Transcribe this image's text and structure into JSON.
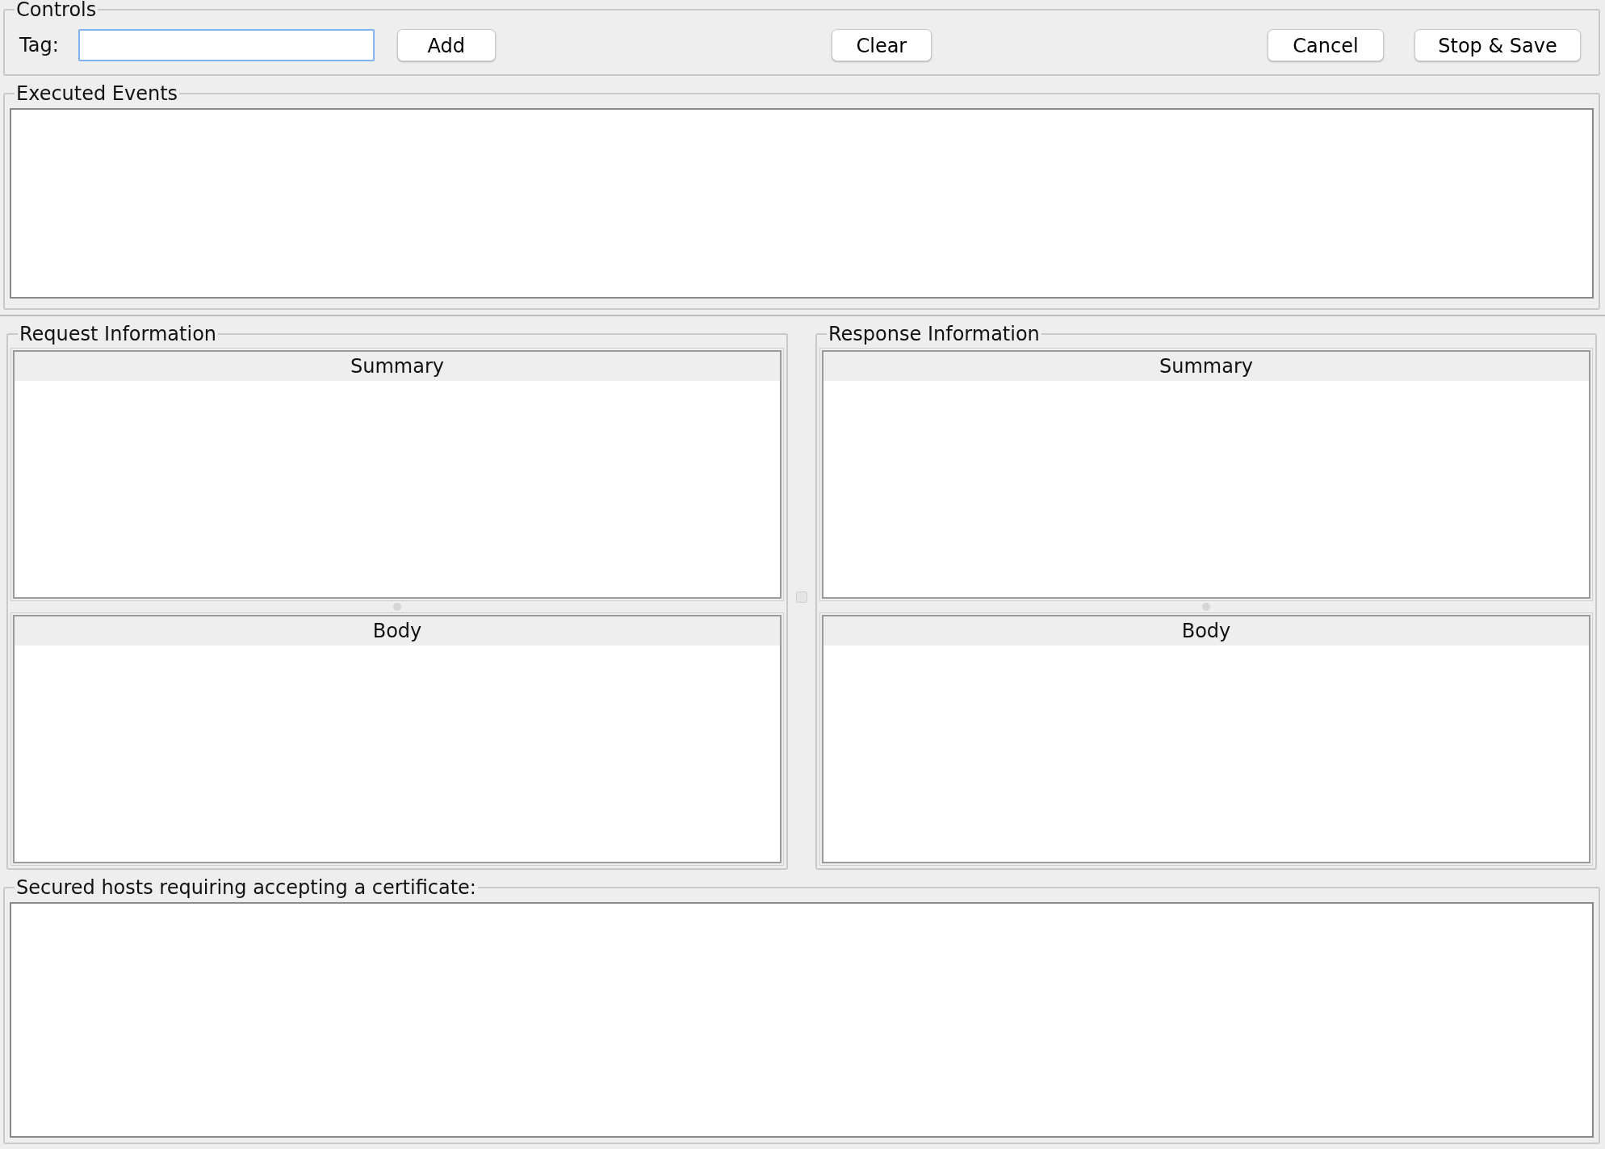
{
  "controls": {
    "title": "Controls",
    "tag_label": "Tag:",
    "buttons": [
      "Add",
      "Clear",
      "Cancel",
      "Stop & Save"
    ]
  },
  "executed_events": {
    "title": "Executed Events"
  },
  "panels": [
    {
      "title": "Request Information",
      "sections": [
        "Summary",
        "Body"
      ]
    },
    {
      "title": "Response Information",
      "sections": [
        "Summary",
        "Body"
      ]
    }
  ],
  "secured_hosts": {
    "title": "Secured hosts requiring accepting a certificate:"
  }
}
